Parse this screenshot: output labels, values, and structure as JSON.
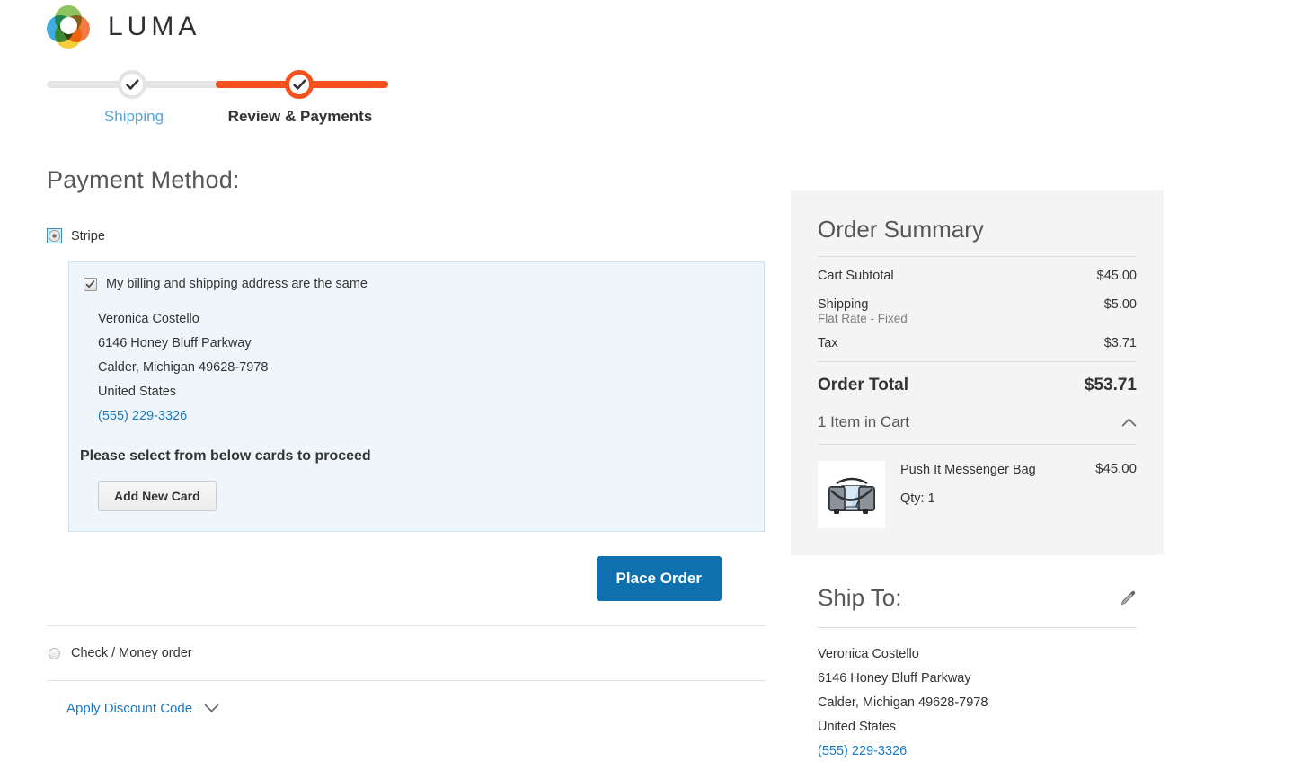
{
  "brand": {
    "name": "LUMA",
    "logo_icon": "luma-ring-logo"
  },
  "progress": {
    "steps": [
      {
        "label": "Shipping",
        "state": "completed",
        "icon": "check-icon"
      },
      {
        "label": "Review & Payments",
        "state": "active",
        "icon": "check-icon"
      }
    ]
  },
  "payment": {
    "title": "Payment Method:",
    "methods": [
      {
        "label": "Stripe",
        "selected": true
      },
      {
        "label": "Check / Money order",
        "selected": false
      }
    ],
    "billing": {
      "same_as_shipping_label": "My billing and shipping address are the same",
      "checked": true,
      "address": {
        "name": "Veronica Costello",
        "street": "6146 Honey Bluff Parkway",
        "city_state_zip": "Calder, Michigan 49628-7978",
        "country": "United States",
        "phone": "(555) 229-3326"
      },
      "cards_prompt": "Please select from below cards to proceed",
      "add_card_label": "Add New Card"
    },
    "place_order_label": "Place Order",
    "discount_label": "Apply Discount Code"
  },
  "summary": {
    "title": "Order Summary",
    "rows": [
      {
        "label": "Cart Subtotal",
        "value": "$45.00",
        "sub": ""
      },
      {
        "label": "Shipping",
        "value": "$5.00",
        "sub": "Flat Rate - Fixed"
      },
      {
        "label": "Tax",
        "value": "$3.71",
        "sub": ""
      }
    ],
    "total_label": "Order Total",
    "total_value": "$53.71",
    "cart_header": "1 Item in Cart",
    "items": [
      {
        "name": "Push It Messenger Bag",
        "price": "$45.00",
        "qty": "Qty: 1",
        "image_icon": "messenger-bag-thumbnail"
      }
    ]
  },
  "ship_to": {
    "title": "Ship To:",
    "edit_icon": "pencil-icon",
    "address": {
      "name": "Veronica Costello",
      "street": "6146 Honey Bluff Parkway",
      "city_state_zip": "Calder, Michigan 49628-7978",
      "country": "United States",
      "phone": "(555) 229-3326"
    }
  },
  "colors": {
    "accent_orange": "#f4511e",
    "link_blue": "#1979c3",
    "button_blue": "#0e70ae",
    "panel_grey": "#f4f4f4",
    "step_inactive": "#e4e4e4"
  }
}
